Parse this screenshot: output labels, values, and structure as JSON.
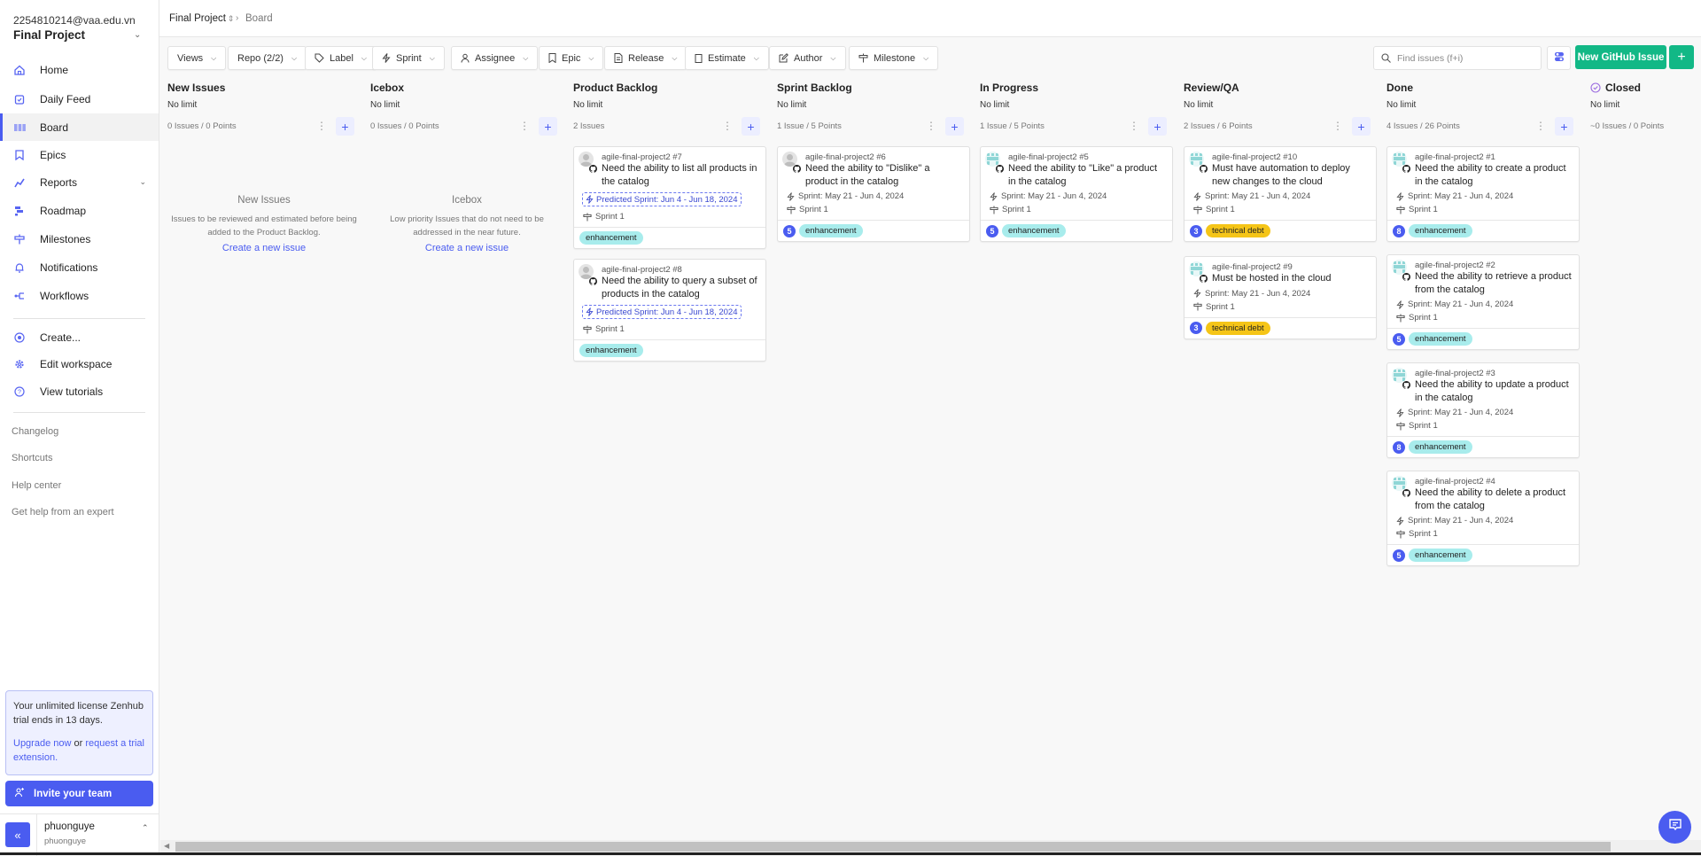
{
  "workspace": {
    "email": "2254810214@vaa.edu.vn",
    "name": "Final Project"
  },
  "sidebar": {
    "items": [
      {
        "label": "Home",
        "icon": "home-icon"
      },
      {
        "label": "Daily Feed",
        "icon": "daily-feed-icon"
      },
      {
        "label": "Board",
        "icon": "board-icon",
        "active": true
      },
      {
        "label": "Epics",
        "icon": "epic-icon"
      },
      {
        "label": "Reports",
        "icon": "reports-icon",
        "expandable": true
      },
      {
        "label": "Roadmap",
        "icon": "roadmap-icon"
      },
      {
        "label": "Milestones",
        "icon": "milestone-icon"
      },
      {
        "label": "Notifications",
        "icon": "bell-icon"
      },
      {
        "label": "Workflows",
        "icon": "workflow-icon"
      }
    ],
    "actions": [
      {
        "label": "Create...",
        "icon": "plus-circle-icon"
      },
      {
        "label": "Edit workspace",
        "icon": "gear-icon"
      },
      {
        "label": "View tutorials",
        "icon": "help-icon"
      }
    ],
    "links": [
      "Changelog",
      "Shortcuts",
      "Help center",
      "Get help from an expert"
    ],
    "trial": {
      "text": "Your unlimited license Zenhub trial ends in 13 days.",
      "upgrade": "Upgrade now",
      "or": " or ",
      "request": "request a trial extension."
    },
    "invite_label": "Invite your team",
    "collapse_icon": "«",
    "user": {
      "name": "phuonguye",
      "handle": "phuonguye"
    }
  },
  "breadcrumb": {
    "project": "Final Project",
    "page": "Board"
  },
  "filters": [
    {
      "label": "Views",
      "icon": ""
    },
    {
      "label": "Repo (2/2)",
      "icon": ""
    },
    {
      "label": "Label",
      "icon": "tag-icon"
    },
    {
      "label": "Sprint",
      "icon": "sprint-icon"
    },
    {
      "label": "Assignee",
      "icon": "user-icon"
    },
    {
      "label": "Epic",
      "icon": "epic-icon"
    },
    {
      "label": "Release",
      "icon": "release-icon"
    },
    {
      "label": "Estimate",
      "icon": "estimate-icon"
    },
    {
      "label": "Author",
      "icon": "edit-icon"
    },
    {
      "label": "Milestone",
      "icon": "milestone-icon"
    }
  ],
  "search": {
    "placeholder": "Find issues (f+i)"
  },
  "buttons": {
    "new_issue": "New GitHub Issue",
    "plus": "+"
  },
  "colors": {
    "accent": "#4a5cf0",
    "primary_green": "#12b886",
    "enhancement": "#a8ecec",
    "technical_debt": "#f5c518"
  },
  "columns": [
    {
      "title": "New Issues",
      "limit": "No limit",
      "count": "0 Issues / 0 Points",
      "empty": {
        "heading": "New Issues",
        "text": "Issues to be reviewed and estimated before being added to the Product Backlog.",
        "link": "Create a new issue"
      },
      "cards": []
    },
    {
      "title": "Icebox",
      "limit": "No limit",
      "count": "0 Issues / 0 Points",
      "empty": {
        "heading": "Icebox",
        "text": "Low priority Issues that do not need to be addressed in the near future.",
        "link": "Create a new issue"
      },
      "cards": []
    },
    {
      "title": "Product Backlog",
      "limit": "No limit",
      "count": "2 Issues",
      "cards": [
        {
          "repo": "agile-final-project2 #7",
          "title": "Need the ability to list all products in the catalog",
          "predicted": "Predicted Sprint: Jun 4 - Jun 18, 2024",
          "milestone": "Sprint 1",
          "estimate": "",
          "label": "enhancement",
          "avatar": "grey"
        },
        {
          "repo": "agile-final-project2 #8",
          "title": "Need the ability to query a subset of products in the catalog",
          "predicted": "Predicted Sprint: Jun 4 - Jun 18, 2024",
          "milestone": "Sprint 1",
          "estimate": "",
          "label": "enhancement",
          "avatar": "grey"
        }
      ]
    },
    {
      "title": "Sprint Backlog",
      "limit": "No limit",
      "count": "1 Issue / 5 Points",
      "cards": [
        {
          "repo": "agile-final-project2 #6",
          "title": "Need the ability to \"Dislike\" a product in the catalog",
          "sprint": "Sprint: May 21 - Jun 4, 2024",
          "milestone": "Sprint 1",
          "estimate": "5",
          "label": "enhancement",
          "avatar": "grey"
        }
      ]
    },
    {
      "title": "In Progress",
      "limit": "No limit",
      "count": "1 Issue / 5 Points",
      "cards": [
        {
          "repo": "agile-final-project2 #5",
          "title": "Need the ability to \"Like\" a product in the catalog",
          "sprint": "Sprint: May 21 - Jun 4, 2024",
          "milestone": "Sprint 1",
          "estimate": "5",
          "label": "enhancement",
          "avatar": "teal"
        }
      ]
    },
    {
      "title": "Review/QA",
      "limit": "No limit",
      "count": "2 Issues / 6 Points",
      "cards": [
        {
          "repo": "agile-final-project2 #10",
          "title": "Must have automation to deploy new changes to the cloud",
          "sprint": "Sprint: May 21 - Jun 4, 2024",
          "milestone": "Sprint 1",
          "estimate": "3",
          "label": "technical debt",
          "avatar": "teal"
        },
        {
          "repo": "agile-final-project2 #9",
          "title": "Must be hosted in the cloud",
          "sprint": "Sprint: May 21 - Jun 4, 2024",
          "milestone": "Sprint 1",
          "estimate": "3",
          "label": "technical debt",
          "avatar": "teal"
        }
      ]
    },
    {
      "title": "Done",
      "limit": "No limit",
      "count": "4 Issues / 26 Points",
      "cards": [
        {
          "repo": "agile-final-project2 #1",
          "title": "Need the ability to create a product in the catalog",
          "sprint": "Sprint: May 21 - Jun 4, 2024",
          "milestone": "Sprint 1",
          "estimate": "8",
          "label": "enhancement",
          "avatar": "teal"
        },
        {
          "repo": "agile-final-project2 #2",
          "title": "Need the ability to retrieve a product from the catalog",
          "sprint": "Sprint: May 21 - Jun 4, 2024",
          "milestone": "Sprint 1",
          "estimate": "5",
          "label": "enhancement",
          "avatar": "teal"
        },
        {
          "repo": "agile-final-project2 #3",
          "title": "Need the ability to update a product in the catalog",
          "sprint": "Sprint: May 21 - Jun 4, 2024",
          "milestone": "Sprint 1",
          "estimate": "8",
          "label": "enhancement",
          "avatar": "teal"
        },
        {
          "repo": "agile-final-project2 #4",
          "title": "Need the ability to delete a product from the catalog",
          "sprint": "Sprint: May 21 - Jun 4, 2024",
          "milestone": "Sprint 1",
          "estimate": "5",
          "label": "enhancement",
          "avatar": "teal"
        }
      ]
    },
    {
      "title": "Closed",
      "limit": "No limit",
      "count": "~0 Issues / 0 Points",
      "closed": true,
      "cards": []
    }
  ]
}
